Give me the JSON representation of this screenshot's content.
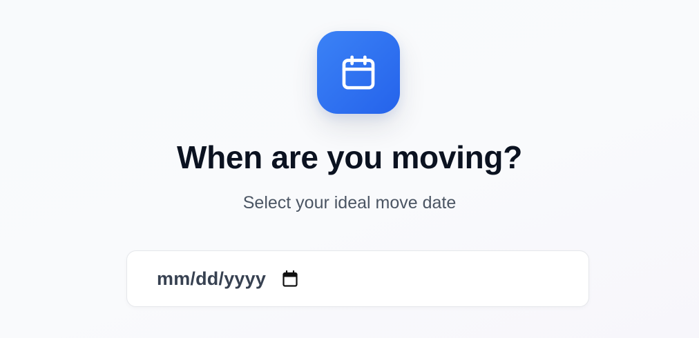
{
  "header": {
    "icon": "calendar-icon",
    "title": "When are you moving?",
    "subtitle": "Select your ideal move date"
  },
  "date_input": {
    "value": "",
    "placeholder": "mm/dd/yyyy",
    "picker_icon": "calendar-picker-icon"
  },
  "colors": {
    "accent": "#2563eb",
    "accent_light": "#3b82f6",
    "title_text": "#0b1220",
    "subtitle_text": "#4b5563",
    "input_text": "#374151",
    "input_border": "#e5e7eb"
  }
}
